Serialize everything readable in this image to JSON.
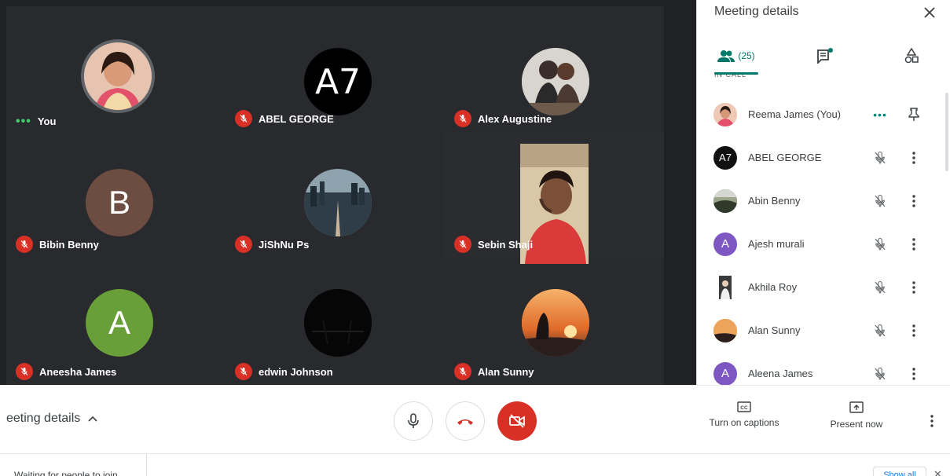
{
  "colors": {
    "grid_bg": "#202124",
    "tile_bg": "#292a2d",
    "mic_off_red": "#d93025",
    "accent_teal": "#00796b",
    "text": "#3c4043",
    "speaking_green": "#3ed06a"
  },
  "tiles": [
    {
      "name": "You",
      "status": "speaking",
      "avatar": {
        "type": "photo",
        "letter": ""
      }
    },
    {
      "name": "ABEL GEORGE",
      "status": "muted",
      "avatar": {
        "type": "initials-image",
        "letter": "A7"
      }
    },
    {
      "name": "Alex Augustine",
      "status": "muted",
      "avatar": {
        "type": "photo",
        "letter": ""
      }
    },
    {
      "name": "Bibin Benny",
      "status": "muted",
      "avatar": {
        "type": "letter",
        "letter": "B",
        "color": "#6d4c41"
      }
    },
    {
      "name": "JiShNu Ps",
      "status": "muted",
      "avatar": {
        "type": "photo",
        "letter": ""
      }
    },
    {
      "name": "Sebin Shaji",
      "status": "muted",
      "avatar": {
        "type": "video",
        "letter": ""
      }
    },
    {
      "name": "Aneesha James",
      "status": "muted",
      "avatar": {
        "type": "letter",
        "letter": "A",
        "color": "#689f38"
      }
    },
    {
      "name": "edwin Johnson",
      "status": "muted",
      "avatar": {
        "type": "photo",
        "letter": ""
      }
    },
    {
      "name": "Alan Sunny",
      "status": "muted",
      "avatar": {
        "type": "photo",
        "letter": ""
      }
    }
  ],
  "panel": {
    "title": "Meeting details",
    "close_icon": "close-icon",
    "tabs": [
      {
        "label": "(25)",
        "icon": "people-icon",
        "active": true
      },
      {
        "label": "",
        "icon": "chat-icon",
        "active": false
      },
      {
        "label": "",
        "icon": "activities-icon",
        "active": false
      }
    ],
    "section_label": "IN CALL",
    "participants": [
      {
        "name": "Reema James (You)",
        "avatar": "photo",
        "letter": "",
        "color": "#e9a28c",
        "status": "speaking"
      },
      {
        "name": "ABEL GEORGE",
        "avatar": "initials-image",
        "letter": "A7",
        "color": "#111111",
        "status": "muted"
      },
      {
        "name": "Abin Benny",
        "avatar": "photo",
        "letter": "",
        "color": "#6b7a5a",
        "status": "muted"
      },
      {
        "name": "Ajesh murali",
        "avatar": "letter",
        "letter": "A",
        "color": "#7e57c2",
        "status": "muted"
      },
      {
        "name": "Akhila Roy",
        "avatar": "photo",
        "letter": "",
        "color": "#3a3a3a",
        "status": "muted"
      },
      {
        "name": "Alan Sunny",
        "avatar": "photo",
        "letter": "",
        "color": "#d98a3f",
        "status": "muted"
      },
      {
        "name": "Aleena James",
        "avatar": "letter",
        "letter": "A",
        "color": "#7e57c2",
        "status": "muted"
      }
    ]
  },
  "bottom_bar": {
    "meeting_details_label": "eeting details",
    "controls": [
      {
        "name": "microphone",
        "icon": "microphone-icon"
      },
      {
        "name": "leave-call",
        "icon": "hang-up-icon"
      },
      {
        "name": "camera-off",
        "icon": "camera-off-icon"
      }
    ],
    "captions_label": "Turn on captions",
    "present_label": "Present now"
  },
  "notification": {
    "text": "Waiting for people to join",
    "show_all_label": "Show all"
  }
}
